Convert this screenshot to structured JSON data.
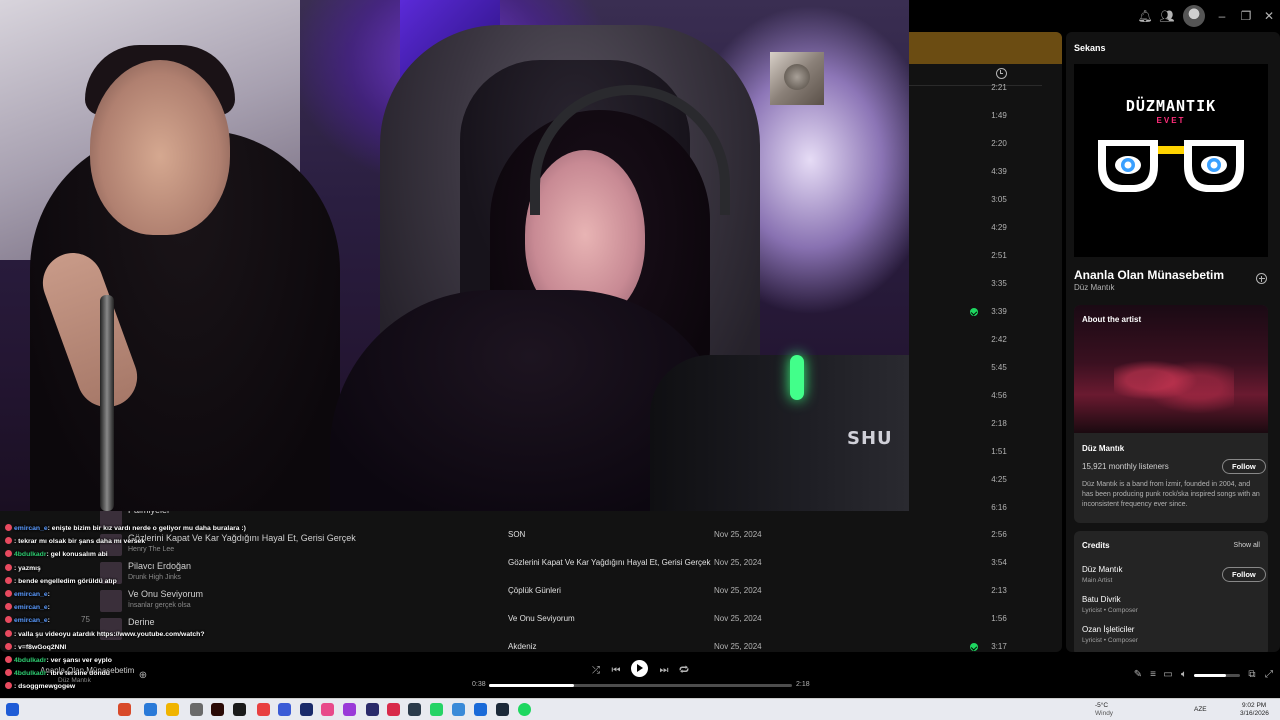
{
  "topbar": {
    "icons": [
      "bell-icon",
      "friends-icon",
      "user-avatar",
      "minimize-icon",
      "maximize-icon",
      "close-icon"
    ]
  },
  "tracklist": {
    "durations_top": [
      "2:21",
      "1:49",
      "2:20",
      "4:39",
      "3:05",
      "4:29",
      "2:51",
      "3:35",
      "3:39",
      "2:42",
      "5:45",
      "4:56",
      "2:18",
      "1:51",
      "4:25",
      "6:16"
    ],
    "rows": [
      {
        "title": "SON",
        "date": "Nov 25, 2024",
        "duration": "2:56",
        "saved": false
      },
      {
        "title": "Gözlerini Kapat Ve Kar Yağdığını Hayal Et, Gerisi Gerçek",
        "date": "Nov 25, 2024",
        "duration": "3:54",
        "saved": false
      },
      {
        "title": "Çöplük Günleri",
        "date": "Nov 25, 2024",
        "duration": "2:13",
        "saved": false
      },
      {
        "title": "Ve Onu Seviyorum",
        "date": "Nov 25, 2024",
        "duration": "1:56",
        "saved": false
      },
      {
        "title": "Akdeniz",
        "date": "Nov 25, 2024",
        "duration": "3:17",
        "saved": true
      }
    ]
  },
  "sidebar_list": [
    {
      "title": "Palmiyeler",
      "sub": ""
    },
    {
      "title": "Gözlerini Kapat Ve Kar Yağdığını Hayal Et, Gerisi Gerçek",
      "sub": "Henry The Lee"
    },
    {
      "title": "Pilavcı Erdoğan",
      "sub": "Drunk High Jinks"
    },
    {
      "title": "Ve Onu Seviyorum",
      "sub": "İnsanlar gerçek olsa"
    },
    {
      "title": "Derine",
      "sub": ""
    }
  ],
  "sidebar_index": "75",
  "right_panel": {
    "title": "Sekans",
    "cover_logo": "DÜZMANTIK",
    "cover_sub": "EVET",
    "track_name": "Ananla Olan Münasebetim",
    "track_artist": "Düz Mantık",
    "about": {
      "heading": "About the artist",
      "artist": "Düz Mantık",
      "listeners": "15,921 monthly listeners",
      "follow": "Follow",
      "bio": "Düz Mantık is a band from İzmir, founded in 2004, and has been producing punk rock/ska inspired songs with an inconsistent frequency ever since."
    },
    "credits": {
      "heading": "Credits",
      "show_all": "Show all",
      "follow": "Follow",
      "people": [
        {
          "name": "Düz Mantık",
          "role": "Main Artist"
        },
        {
          "name": "Batu Divrik",
          "role": "Lyricist • Composer"
        },
        {
          "name": "Ozan İşleticiler",
          "role": "Lyricist • Composer"
        }
      ]
    }
  },
  "player": {
    "now_playing_title": "Ananla Olan Münasebetim",
    "now_playing_artist": "Düz Mantık",
    "elapsed": "0:38",
    "total": "2:18",
    "progress": 0.28,
    "volume": 0.7
  },
  "webcam": {
    "mic_text": "SHU"
  },
  "chat": [
    {
      "user": "emircan_e",
      "color": "blue",
      "text": "enişte bizim bir kız vardı nerde o geliyor mu daha buralara :)"
    },
    {
      "user": "",
      "color": "blue",
      "text": "tekrar mı olsak bir şans daha mı versek"
    },
    {
      "user": "4bdulkadr",
      "color": "green",
      "text": "gel konusalım abi"
    },
    {
      "user": "",
      "color": "blue",
      "text": "yazmış"
    },
    {
      "user": "",
      "color": "blue",
      "text": "bende engelledim görüldü atıp"
    },
    {
      "user": "emircan_e",
      "color": "blue",
      "text": ""
    },
    {
      "user": "emircan_e",
      "color": "blue",
      "text": ""
    },
    {
      "user": "emircan_e",
      "color": "blue",
      "text": ""
    },
    {
      "user": "",
      "color": "blue",
      "text": "valla şu videoyu atardık https://www.youtube.com/watch?"
    },
    {
      "user": "",
      "color": "blue",
      "text": "v=f8wGoq2NNI"
    },
    {
      "user": "4bdulkadr",
      "color": "green",
      "text": "ver şansı ver eyplo"
    },
    {
      "user": "4bdulkadr",
      "color": "green",
      "text": "ibre tersine döndü"
    },
    {
      "user": "",
      "color": "green",
      "text": "dsoggmewgogew"
    }
  ],
  "taskbar": {
    "weather_temp": "-5°C",
    "weather_label": "Windy",
    "lang": "AZE",
    "time": "9:02 PM",
    "date": "3/16/2026"
  }
}
